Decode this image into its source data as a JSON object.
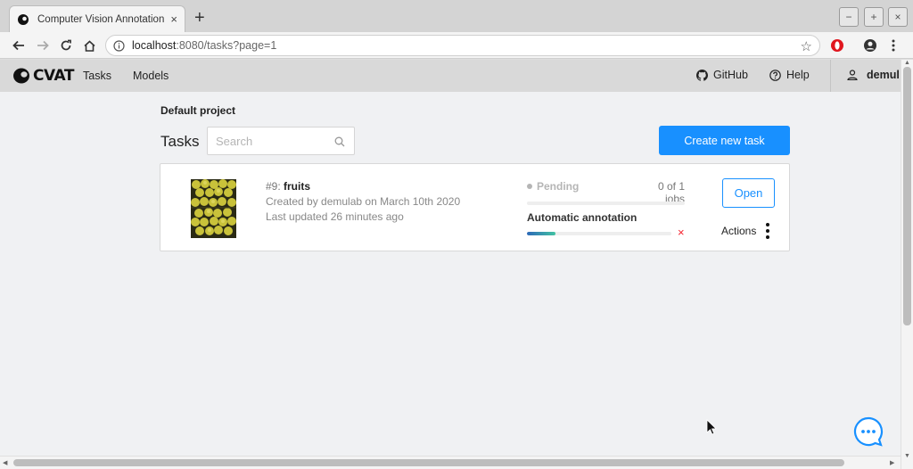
{
  "browser": {
    "tab_title": "Computer Vision Annotation To",
    "tab_close": "×",
    "new_tab": "+",
    "url_host": "localhost",
    "url_path": ":8080/tasks?page=1",
    "window_controls": [
      "−",
      "+",
      "×"
    ]
  },
  "header": {
    "logo": "CVAT",
    "nav": [
      "Tasks",
      "Models"
    ],
    "github": "GitHub",
    "help": "Help",
    "user": "demul"
  },
  "page": {
    "project": "Default project",
    "title": "Tasks",
    "search_placeholder": "Search",
    "create_button": "Create new task"
  },
  "task": {
    "id": "#9: ",
    "name": "fruits",
    "created": "Created by demulab on March 10th 2020",
    "updated": "Last updated 26 minutes ago",
    "status": "Pending",
    "jobs": "0 of 1 jobs",
    "jobs_progress": 0,
    "auto_annotation_label": "Automatic annotation",
    "auto_annotation_progress": 0.2,
    "cancel": "×",
    "open_button": "Open",
    "actions_label": "Actions"
  },
  "colors": {
    "primary": "#1890ff",
    "danger": "#f5222d",
    "header_bg": "#d9d9d9",
    "page_bg": "#f0f1f3"
  }
}
